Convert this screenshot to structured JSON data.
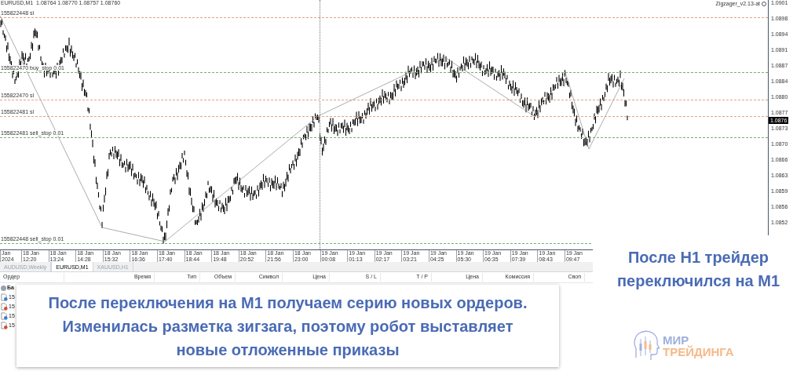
{
  "chart": {
    "header": "EURUSD,M1  1.08764 1.08770 1.08757 1.08760",
    "indicator": "Zigzager_v2.13-at",
    "order_lines": [
      {
        "label": "155822448 sl",
        "kind": "sl"
      },
      {
        "label": "155822470 buy_stop 0.01",
        "kind": "stop"
      },
      {
        "label": "155822470 sl",
        "kind": "sl"
      },
      {
        "label": "155822481 sl",
        "kind": "sl"
      },
      {
        "label": "155822481 sell_stop 0.01",
        "kind": "stop"
      },
      {
        "label": "155822448 sell_stop 0.01",
        "kind": "stop"
      }
    ],
    "price_axis": [
      "1.0901",
      "1.0898",
      "1.0894",
      "1.0891",
      "1.0887",
      "1.0884",
      "1.0880",
      "1.0877",
      "1.0873",
      "1.0870",
      "1.0866",
      "1.0863",
      "1.0859",
      "1.0856",
      "1.0852"
    ],
    "current_price": "1.0876",
    "time_axis": [
      "Jan 2024",
      "18 Jan 12:20",
      "18 Jan 13:24",
      "18 Jan 14:28",
      "18 Jan 15:32",
      "18 Jan 16:36",
      "18 Jan 17:40",
      "18 Jan 18:44",
      "18 Jan 19:48",
      "18 Jan 20:52",
      "18 Jan 21:56",
      "18 Jan 23:00",
      "19 Jan 00:08",
      "19 Jan 01:13",
      "19 Jan 02:17",
      "19 Jan 03:21",
      "19 Jan 04:25",
      "19 Jan 05:30",
      "19 Jan 06:35",
      "19 Jan 07:39",
      "19 Jan 08:43",
      "19 Jan 09:47"
    ]
  },
  "tabs": [
    {
      "label": "AUDUSD,Weekly",
      "selected": false
    },
    {
      "label": "EURUSD,M1",
      "selected": true
    },
    {
      "label": "XAUUSD,H1",
      "selected": false
    }
  ],
  "orders_table": {
    "columns": [
      "Ордер",
      "Время",
      "Тип",
      "Объем",
      "Символ",
      "Цена",
      "S / L",
      "T / P",
      "Цена",
      "Комиссия",
      "Своп"
    ],
    "rows": [
      {
        "kind": "balance",
        "cell": "Ба"
      },
      {
        "kind": "buy",
        "cell": "15"
      },
      {
        "kind": "sell",
        "cell": "15"
      },
      {
        "kind": "buy",
        "cell": "15"
      },
      {
        "kind": "sell",
        "cell": "15"
      }
    ]
  },
  "callouts": [
    {
      "text": "После переключения на М1 получаем серию новых ордеров. Изменилась разметка зигзага, поэтому робот выставляет новые отложенные приказы"
    },
    {
      "text": "После Н1 трейдер переключился на М1"
    }
  ],
  "logo": {
    "line_1": "МИР",
    "line_2": "ТРЕЙДИНГА"
  }
}
